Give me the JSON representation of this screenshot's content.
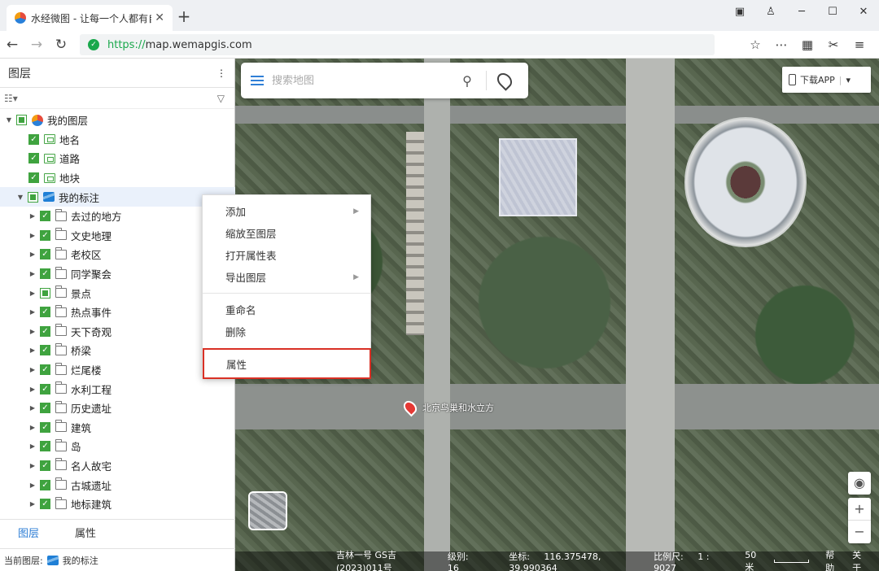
{
  "browser": {
    "tab_title": "水经微图 - 让每一个人都有自",
    "url_scheme": "https://",
    "url_host": "map.wemapgis.com"
  },
  "sidebar": {
    "title": "图层",
    "root": {
      "label": "我的图层"
    },
    "base_layers": [
      {
        "label": "地名"
      },
      {
        "label": "道路"
      },
      {
        "label": "地块"
      }
    ],
    "group": {
      "label": "我的标注"
    },
    "folders": [
      {
        "label": "去过的地方"
      },
      {
        "label": "文史地理"
      },
      {
        "label": "老校区"
      },
      {
        "label": "同学聚会"
      },
      {
        "label": "景点"
      },
      {
        "label": "热点事件"
      },
      {
        "label": "天下奇观"
      },
      {
        "label": "桥梁"
      },
      {
        "label": "烂尾楼"
      },
      {
        "label": "水利工程"
      },
      {
        "label": "历史遗址"
      },
      {
        "label": "建筑"
      },
      {
        "label": "岛"
      },
      {
        "label": "名人故宅"
      },
      {
        "label": "古城遗址"
      },
      {
        "label": "地标建筑"
      }
    ],
    "tabs": {
      "layers": "图层",
      "properties": "属性"
    },
    "status": {
      "label": "当前图层:",
      "value": "我的标注"
    }
  },
  "map": {
    "search_placeholder": "搜索地图",
    "app_button": "下载APP",
    "poi_label": "北京鸟巢和水立方",
    "status": {
      "source": "吉林一号 GS吉(2023)011号",
      "level_label": "级别:",
      "level": "16",
      "coord_label": "坐标:",
      "coord": "116.375478, 39.990364",
      "scale_label": "比例尺:",
      "scale": "1 : 9027",
      "scalebar": "50米",
      "help": "帮助",
      "about": "关于"
    }
  },
  "context_menu": {
    "add": "添加",
    "zoom": "缩放至图层",
    "open_table": "打开属性表",
    "export": "导出图层",
    "rename": "重命名",
    "delete": "删除",
    "properties": "属性"
  }
}
